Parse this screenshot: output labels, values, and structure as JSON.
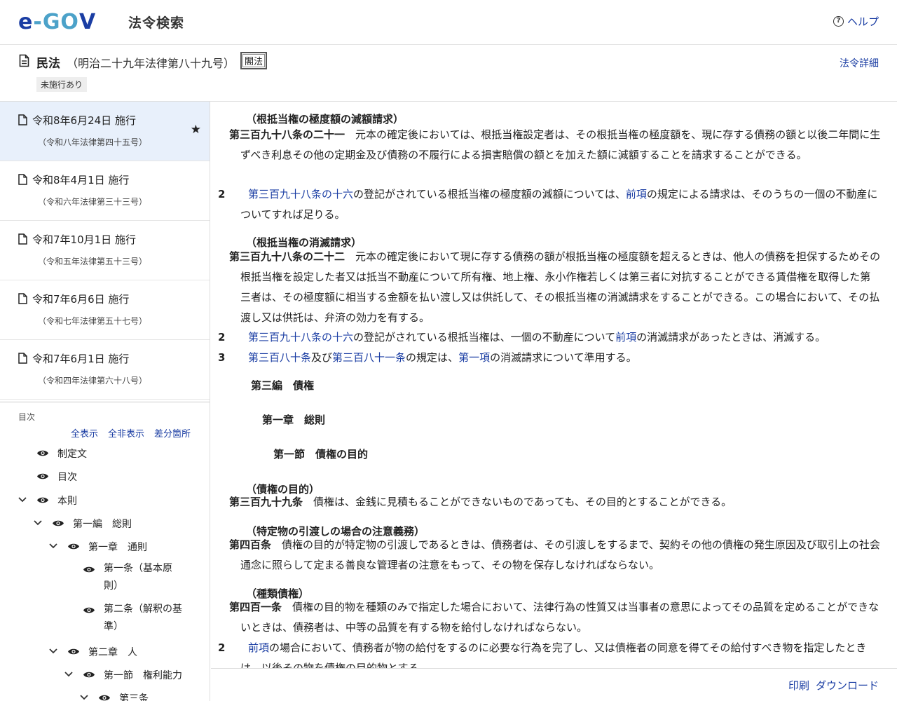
{
  "header": {
    "logo_e": "e",
    "logo_dash": "-",
    "logo_go": "GO",
    "logo_v": "V",
    "site_title": "法令検索",
    "help_label": "ヘルプ"
  },
  "law": {
    "name": "民法",
    "number": "（明治二十九年法律第八十九号）",
    "badge": "閣法",
    "status": "未施行あり",
    "detail_link": "法令詳細"
  },
  "versions": [
    {
      "date": "令和8年6月24日 施行",
      "law": "（令和八年法律第四十五号）",
      "active": true
    },
    {
      "date": "令和8年4月1日 施行",
      "law": "（令和六年法律第三十三号）"
    },
    {
      "date": "令和7年10月1日 施行",
      "law": "（令和五年法律第五十三号）"
    },
    {
      "date": "令和7年6月6日 施行",
      "law": "（令和七年法律第五十七号）"
    },
    {
      "date": "令和7年6月1日 施行",
      "law": "（令和四年法律第六十八号）"
    }
  ],
  "toc": {
    "label": "目次",
    "show_all": "全表示",
    "hide_all": "全非表示",
    "diff": "差分箇所",
    "items": [
      {
        "label": "制定文"
      },
      {
        "label": "目次"
      },
      {
        "label": "本則"
      },
      {
        "label": "第一編　総則"
      },
      {
        "label": "第一章　通則"
      },
      {
        "label": "第一条（基本原則）",
        "line1": "第一条（基本原",
        "line2": "則）"
      },
      {
        "label": "第二条（解釈の基準）",
        "line1": "第二条（解釈の基",
        "line2": "準）"
      },
      {
        "label": "第二章　人"
      },
      {
        "label": "第一節　権利能力"
      },
      {
        "label": "第三条"
      }
    ]
  },
  "content": {
    "a1_caption": "（根抵当権の極度額の減額請求）",
    "a1_title": "第三百九十八条の二十一",
    "a1_text": "元本の確定後においては、根抵当権設定者は、その根抵当権の極度額を、現に存する債務の額と以後二年間に生ずべき利息その他の定期金及び債務の不履行による損害賠償の額とを加えた額に減額することを請求することができる。",
    "a1_p2_num": "2",
    "a1_p2_link1": "第三百九十八条の十六",
    "a1_p2_t1": "の登記がされている根抵当権の極度額の減額については、",
    "a1_p2_link2": "前項",
    "a1_p2_t2": "の規定による請求は、そのうちの一個の不動産についてすれば足りる。",
    "a2_caption": "（根抵当権の消滅請求）",
    "a2_title": "第三百九十八条の二十二",
    "a2_text": "元本の確定後において現に存する債務の額が根抵当権の極度額を超えるときは、他人の債務を担保するためその根抵当権を設定した者又は抵当不動産について所有権、地上権、永小作権若しくは第三者に対抗することができる賃借権を取得した第三者は、その極度額に相当する金額を払い渡し又は供託して、その根抵当権の消滅請求をすることができる。この場合において、その払渡し又は供託は、弁済の効力を有する。",
    "a2_p2_num": "2",
    "a2_p2_link1": "第三百九十八条の十六",
    "a2_p2_t1": "の登記がされている根抵当権は、一個の不動産について",
    "a2_p2_link2": "前項",
    "a2_p2_t2": "の消滅請求があったときは、消滅する。",
    "a2_p3_num": "3",
    "a2_p3_link1": "第三百八十条",
    "a2_p3_t1": "及び",
    "a2_p3_link2": "第三百八十一条",
    "a2_p3_t2": "の規定は、",
    "a2_p3_link3": "第一項",
    "a2_p3_t3": "の消滅請求について準用する。",
    "part": "第三編　債権",
    "chapter": "第一章　総則",
    "section": "第一節　債権の目的",
    "a3_caption": "（債権の目的）",
    "a3_title": "第三百九十九条",
    "a3_text": "債権は、金銭に見積もることができないものであっても、その目的とすることができる。",
    "a4_caption": "（特定物の引渡しの場合の注意義務）",
    "a4_title": "第四百条",
    "a4_text": "債権の目的が特定物の引渡しであるときは、債務者は、その引渡しをするまで、契約その他の債権の発生原因及び取引上の社会通念に照らして定まる善良な管理者の注意をもって、その物を保存しなければならない。",
    "a5_caption": "（種類債権）",
    "a5_title": "第四百一条",
    "a5_text": "債権の目的物を種類のみで指定した場合において、法律行為の性質又は当事者の意思によってその品質を定めることができないときは、債務者は、中等の品質を有する物を給付しなければならない。",
    "a5_p2_num": "2",
    "a5_p2_link1": "前項",
    "a5_p2_t1": "の場合において、債務者が物の給付をするのに必要な行為を完了し、又は債権者の同意を得てその給付すべき物を指定したときは、以後その物を債権の目的物とする。"
  },
  "footer": {
    "print": "印刷",
    "download": "ダウンロード"
  }
}
